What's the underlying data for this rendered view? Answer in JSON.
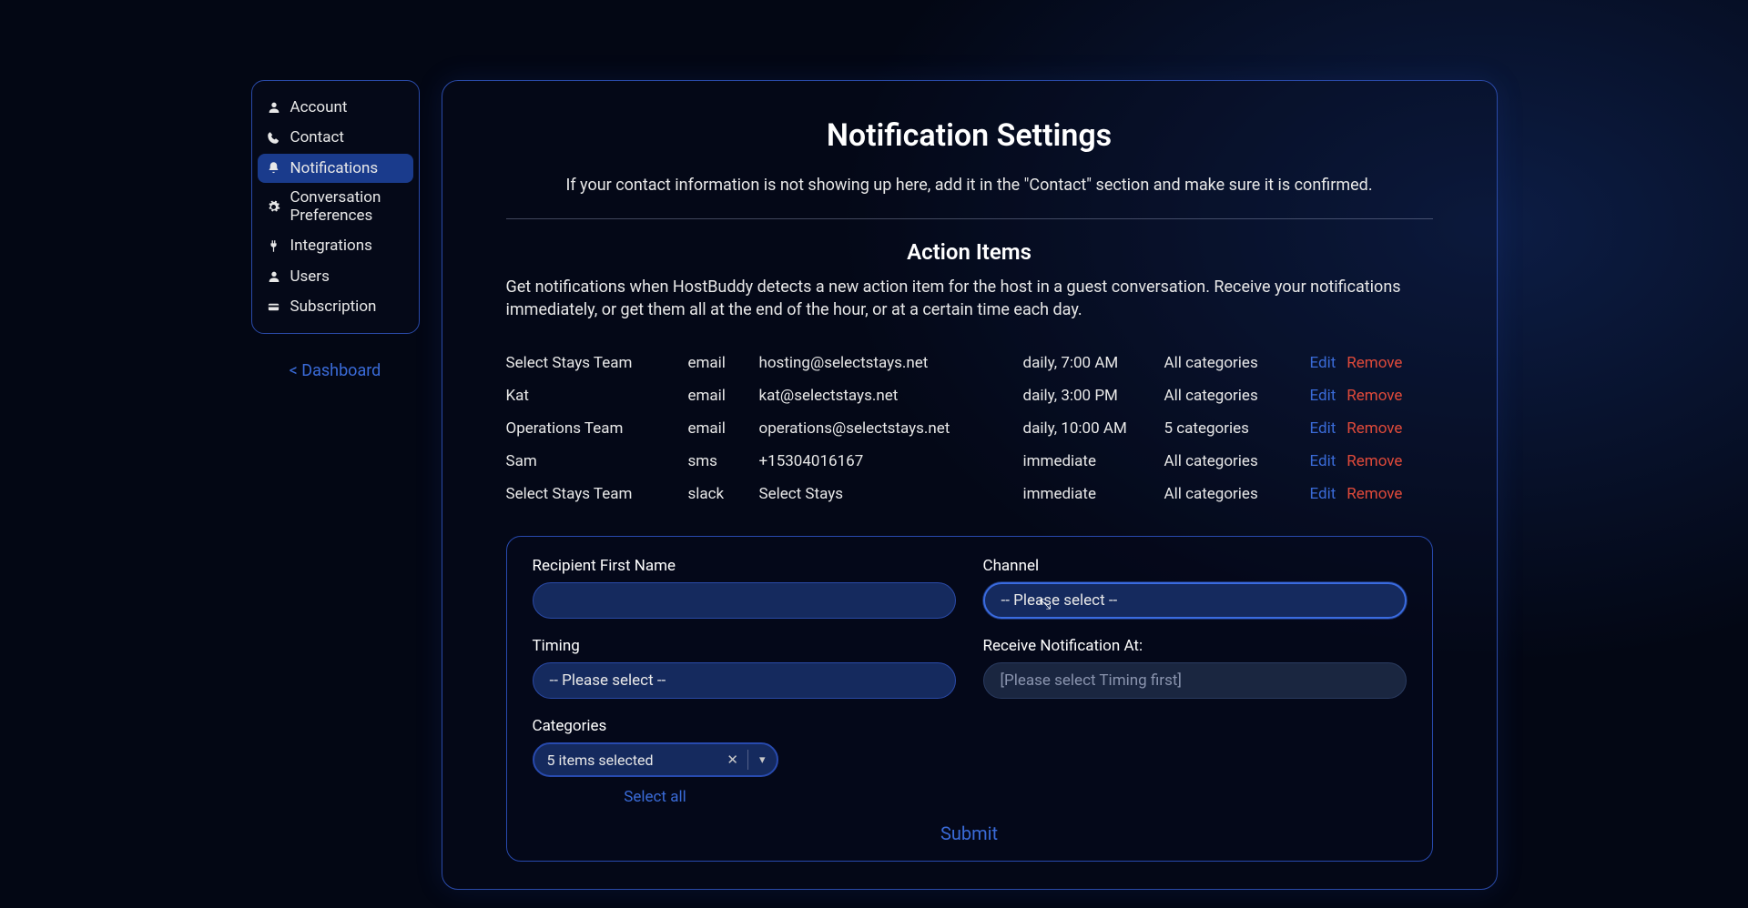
{
  "sidebar": {
    "items": [
      {
        "label": "Account"
      },
      {
        "label": "Contact"
      },
      {
        "label": "Notifications"
      },
      {
        "label": "Conversation Preferences"
      },
      {
        "label": "Integrations"
      },
      {
        "label": "Users"
      },
      {
        "label": "Subscription"
      }
    ],
    "dashboard_link": "< Dashboard"
  },
  "page": {
    "title": "Notification Settings",
    "description": "If your contact information is not showing up here, add it in the \"Contact\" section and make sure it is confirmed."
  },
  "section": {
    "title": "Action Items",
    "description": "Get notifications when HostBuddy detects a new action item for the host in a guest conversation. Receive your notifications immediately, or get them all at the end of the hour, or at a certain time each day."
  },
  "rules": [
    {
      "name": "Select Stays Team",
      "channel": "email",
      "destination": "hosting@selectstays.net",
      "timing": "daily, 7:00 AM",
      "categories": "All categories"
    },
    {
      "name": "Kat",
      "channel": "email",
      "destination": "kat@selectstays.net",
      "timing": "daily, 3:00 PM",
      "categories": "All categories"
    },
    {
      "name": "Operations Team",
      "channel": "email",
      "destination": "operations@selectstays.net",
      "timing": "daily, 10:00 AM",
      "categories": "5 categories"
    },
    {
      "name": "Sam",
      "channel": "sms",
      "destination": "+15304016167",
      "timing": "immediate",
      "categories": "All categories"
    },
    {
      "name": "Select Stays Team",
      "channel": "slack",
      "destination": "Select Stays",
      "timing": "immediate",
      "categories": "All categories"
    }
  ],
  "actions": {
    "edit": "Edit",
    "remove": "Remove"
  },
  "form": {
    "recipient_label": "Recipient First Name",
    "channel_label": "Channel",
    "channel_placeholder": "-- Please select --",
    "timing_label": "Timing",
    "timing_placeholder": "-- Please select --",
    "receive_at_label": "Receive Notification At:",
    "receive_at_placeholder": "[Please select Timing first]",
    "categories_label": "Categories",
    "categories_value": "5 items selected",
    "select_all": "Select all",
    "submit": "Submit"
  }
}
